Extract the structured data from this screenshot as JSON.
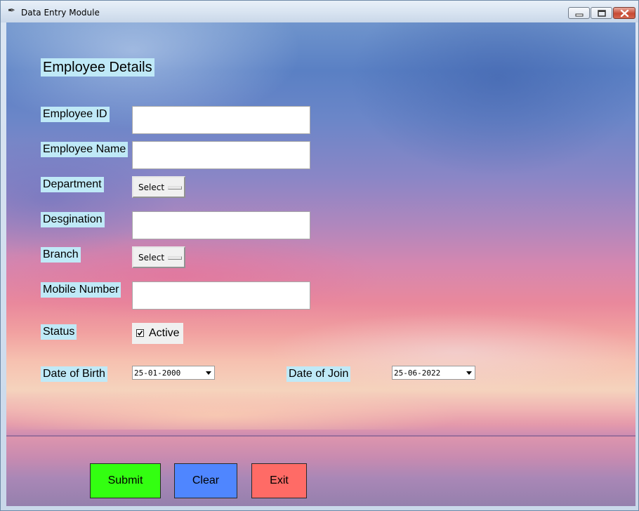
{
  "window": {
    "title": "Data Entry Module",
    "controls": {
      "minimize": "minimize-icon",
      "maximize": "maximize-icon",
      "close": "close-icon"
    }
  },
  "form": {
    "heading": "Employee Details",
    "fields": {
      "employee_id": {
        "label": "Employee ID",
        "value": ""
      },
      "employee_name": {
        "label": "Employee Name",
        "value": ""
      },
      "department": {
        "label": "Department",
        "selected": "Select"
      },
      "designation": {
        "label": "Desgination",
        "value": ""
      },
      "branch": {
        "label": "Branch",
        "selected": "Select"
      },
      "mobile": {
        "label": "Mobile Number",
        "value": ""
      },
      "status": {
        "label": "Status",
        "checkbox_label": "Active",
        "checked": true
      },
      "dob": {
        "label": "Date of Birth",
        "value": "25-01-2000"
      },
      "doj": {
        "label": "Date of Join",
        "value": "25-06-2022"
      }
    },
    "buttons": {
      "submit": "Submit",
      "clear": "Clear",
      "exit": "Exit"
    }
  },
  "colors": {
    "label_bg": "#bfe9f7",
    "submit": "#33ff11",
    "clear": "#4f86ff",
    "exit": "#ff6b66"
  }
}
